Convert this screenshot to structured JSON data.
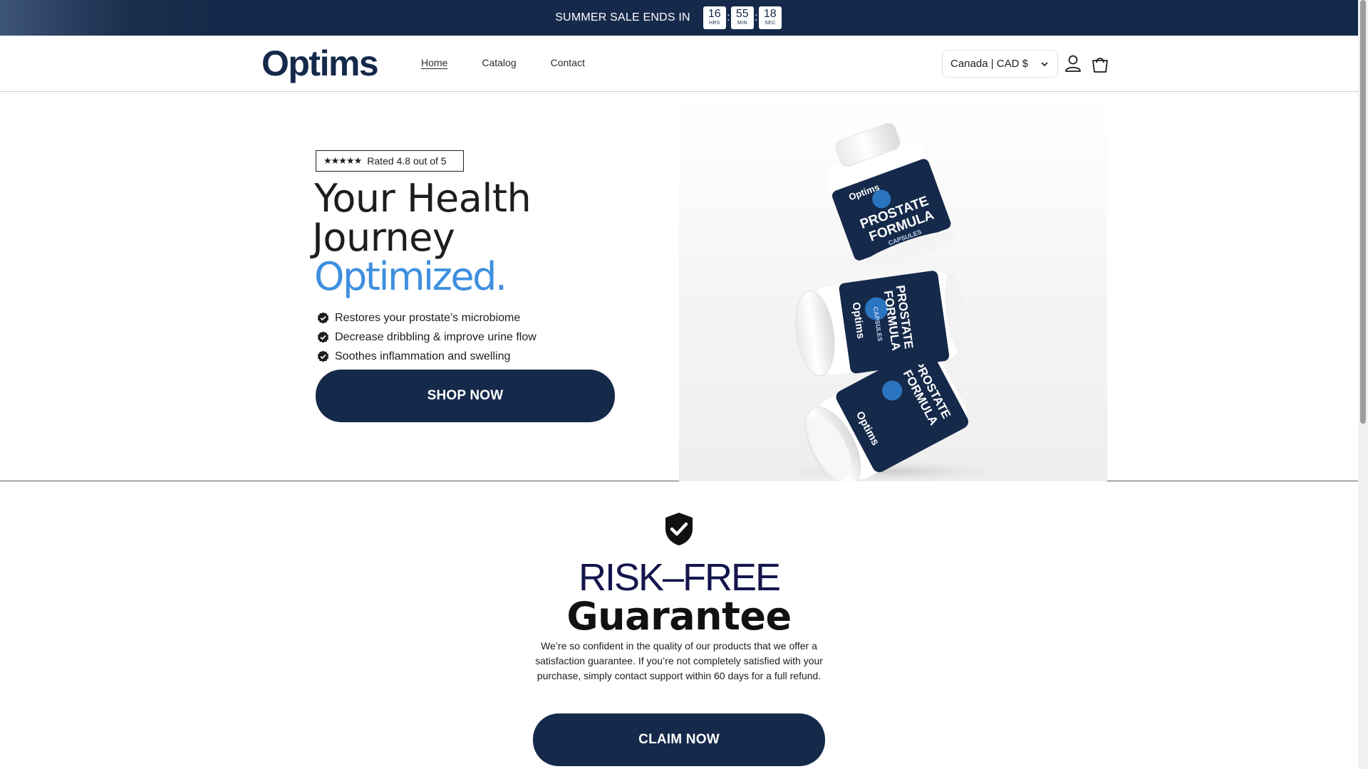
{
  "announcement": {
    "text": "SUMMER SALE ENDS IN",
    "countdown": [
      {
        "value": "16",
        "unit": "HRS"
      },
      {
        "value": "55",
        "unit": "MIN"
      },
      {
        "value": "18",
        "unit": "SEC"
      }
    ],
    "separator": ":"
  },
  "header": {
    "logo": "Optims",
    "nav": [
      "Home",
      "Catalog",
      "Contact"
    ],
    "currency": "Canada | CAD $",
    "icons": [
      "account-icon",
      "cart-icon",
      "chevron-down-icon"
    ]
  },
  "hero": {
    "rating_stars": "★★★★★",
    "rating_text": "Rated 4.8 out of 5",
    "headline_line1": "Your Health",
    "headline_line2": "Journey",
    "headline_accent": "Optimized.",
    "benefits": [
      "Restores your prostate’s microbiome",
      "Decrease dribbling & improve urine flow",
      "Soothes inflammation and swelling"
    ],
    "cta": "SHOP NOW",
    "product_brand": "Optims",
    "product_name_line1": "PROSTATE",
    "product_name_line2": "FORMULA",
    "product_type": "CAPSULES"
  },
  "guarantee": {
    "icon": "shield-check-icon",
    "title_line1": "RISK–FREE",
    "title_line2": "Guarantee",
    "body": "We’re so confident in the quality of our products that we offer a satisfaction guarantee. If you’re not completely satisfied with your purchase, simply contact support within 60 days for a full refund.",
    "cta": "CLAIM NOW"
  },
  "colors": {
    "brand_navy": "#15294a",
    "accent_blue": "#3e8fe0",
    "title_navy": "#15154d"
  }
}
